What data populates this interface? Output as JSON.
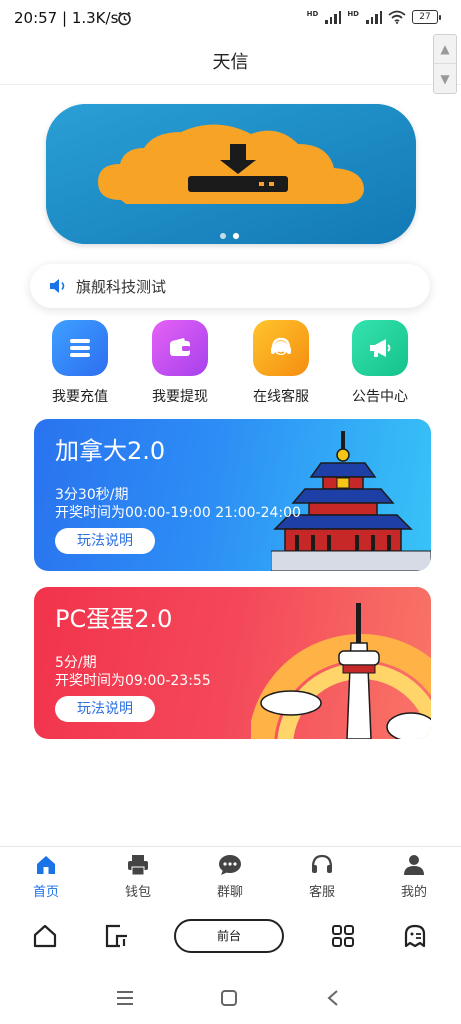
{
  "status_bar": {
    "time": "20:57 | 1.3K/s",
    "battery": "27"
  },
  "header": {
    "title": "天信"
  },
  "banner": {
    "image": "cloud-download-icon",
    "dots": 2,
    "active_dot": 2
  },
  "notice": {
    "text": "旗舰科技测试",
    "icon": "speaker-icon"
  },
  "quick_menu": [
    {
      "label": "我要充值",
      "icon": "stack-icon",
      "color": "#2f7cf6"
    },
    {
      "label": "我要提现",
      "icon": "wallet-icon",
      "color": "#c24ef0"
    },
    {
      "label": "在线客服",
      "icon": "headset-icon",
      "color": "#f7a21b"
    },
    {
      "label": "公告中心",
      "icon": "megaphone-icon",
      "color": "#1fcf9a"
    }
  ],
  "games": [
    {
      "title": "加拿大2.0",
      "line1": "3分30秒/期",
      "line2": "开奖时间为00:00-19:00 21:00-24:00",
      "button": "玩法说明"
    },
    {
      "title": "PC蛋蛋2.0",
      "line1": "5分/期",
      "line2": "开奖时间为09:00-23:55",
      "button": "玩法说明"
    }
  ],
  "tabbar": [
    {
      "label": "首页",
      "icon": "home-icon",
      "active": true
    },
    {
      "label": "钱包",
      "icon": "printer-icon",
      "active": false
    },
    {
      "label": "群聊",
      "icon": "chat-icon",
      "active": false
    },
    {
      "label": "客服",
      "icon": "headset-icon",
      "active": false
    },
    {
      "label": "我的",
      "icon": "user-icon",
      "active": false
    }
  ],
  "browser_bar": {
    "center_label": "前台"
  },
  "colors": {
    "accent": "#1a73e8",
    "card_blue": "#2d8ef5",
    "card_red": "#f2334b"
  }
}
